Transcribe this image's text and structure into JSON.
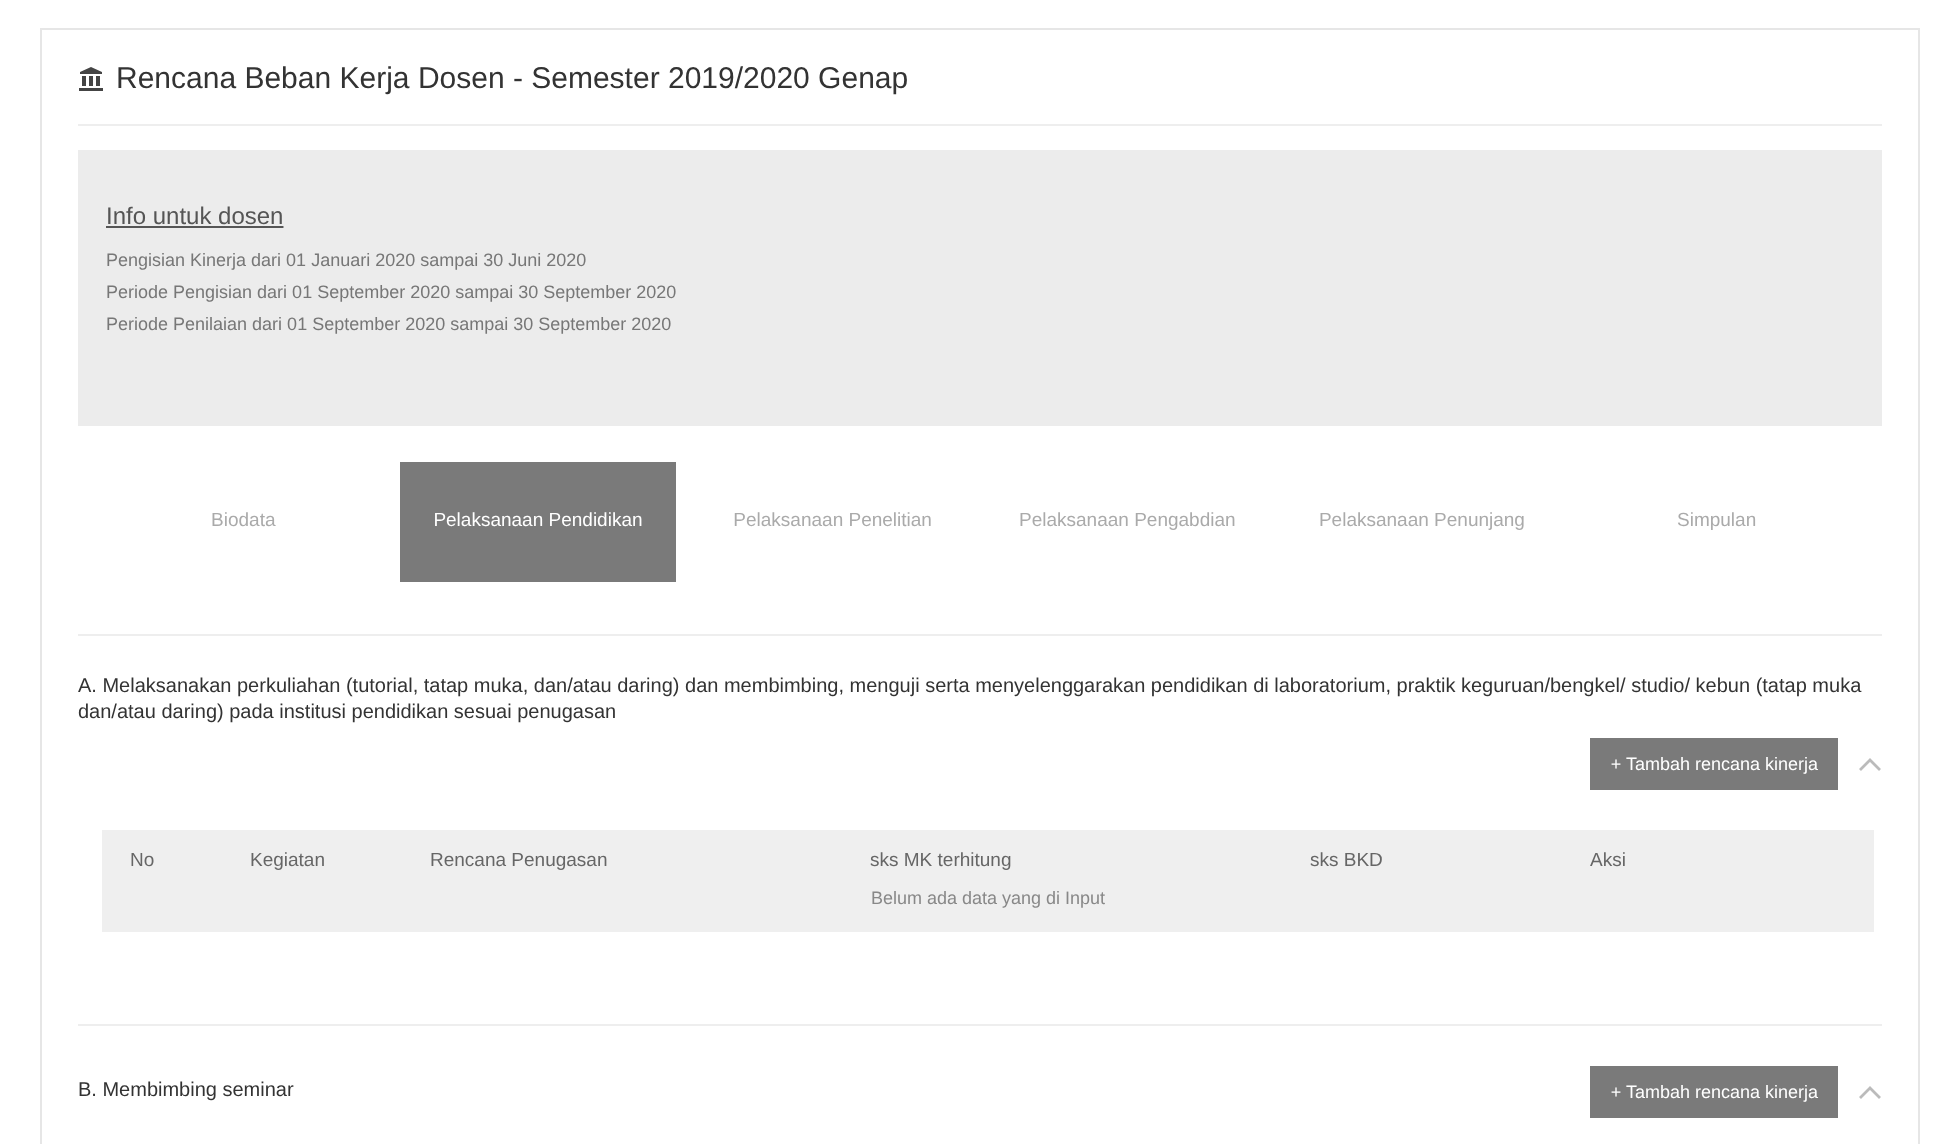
{
  "page": {
    "title": "Rencana Beban Kerja Dosen - Semester 2019/2020 Genap"
  },
  "info": {
    "heading": "Info untuk dosen",
    "lines": [
      "Pengisian Kinerja dari 01 Januari 2020 sampai 30 Juni 2020",
      "Periode Pengisian dari 01 September 2020 sampai 30 September 2020",
      "Periode Penilaian dari 01 September 2020 sampai 30 September 2020"
    ]
  },
  "tabs": [
    {
      "label": "Biodata",
      "selected": false
    },
    {
      "label": "Pelaksanaan Pendidikan",
      "selected": true
    },
    {
      "label": "Pelaksanaan Penelitian",
      "selected": false
    },
    {
      "label": "Pelaksanaan Pengabdian",
      "selected": false
    },
    {
      "label": "Pelaksanaan Penunjang",
      "selected": false
    },
    {
      "label": "Simpulan",
      "selected": false
    }
  ],
  "sections": [
    {
      "title": "A. Melaksanakan perkuliahan (tutorial, tatap muka, dan/atau daring) dan membimbing, menguji serta menyelenggarakan pendidikan di laboratorium, praktik keguruan/bengkel/ studio/ kebun (tatap muka dan/atau daring) pada institusi pendidikan sesuai penugasan",
      "button": "+ Tambah rencana kinerja",
      "expanded": true,
      "table": {
        "columns": [
          "No",
          "Kegiatan",
          "Rencana Penugasan",
          "sks MK terhitung",
          "sks BKD",
          "Aksi"
        ],
        "empty": "Belum ada data yang di Input"
      }
    },
    {
      "title": "B. Membimbing seminar",
      "button": "+ Tambah rencana kinerja",
      "expanded": true
    }
  ]
}
